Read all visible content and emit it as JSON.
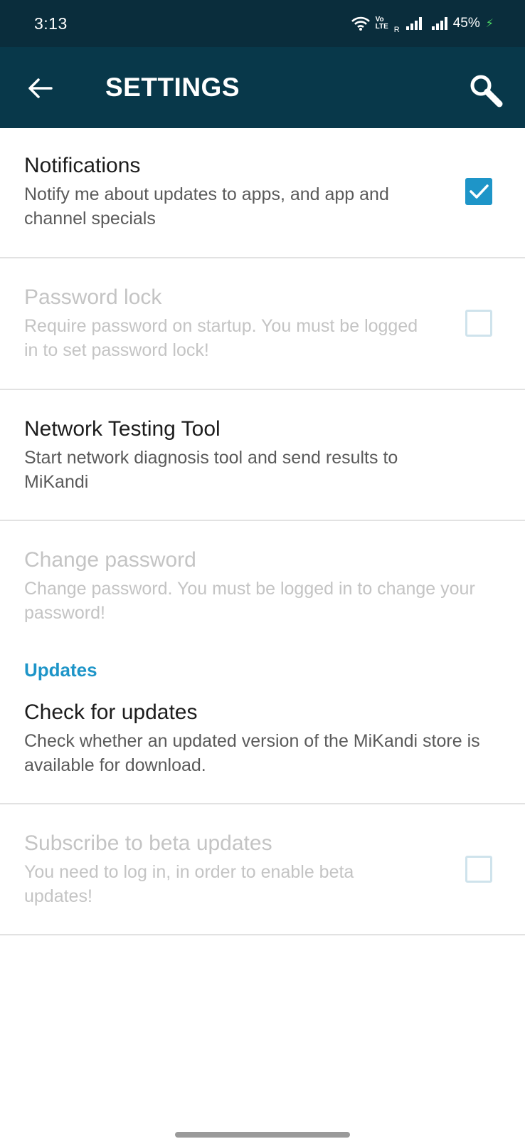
{
  "status_bar": {
    "time": "3:13",
    "volte_top": "Vo",
    "volte_bottom": "LTE",
    "roaming": "R",
    "battery": "45%",
    "icons": [
      "wifi-icon",
      "volte-icon",
      "signal-icon",
      "signal-icon",
      "charging-icon"
    ]
  },
  "app_bar": {
    "title": "SETTINGS",
    "back_icon": "arrow-left-icon",
    "search_icon": "search-icon"
  },
  "settings": [
    {
      "title": "Notifications",
      "desc": "Notify me about updates to apps, and app and channel specials",
      "checkbox": "checked",
      "enabled": true
    },
    {
      "title": "Password lock",
      "desc": "Require password on startup. You must be logged in to set password lock!",
      "checkbox": "unchecked",
      "enabled": false
    },
    {
      "title": "Network Testing Tool",
      "desc": "Start network diagnosis tool and send results to MiKandi",
      "enabled": true
    },
    {
      "title": "Change password",
      "desc": "Change password. You must be logged in to change your password!",
      "enabled": false
    }
  ],
  "updates_section": {
    "header": "Updates",
    "items": [
      {
        "title": "Check for updates",
        "desc": "Check whether an updated version of the MiKandi store is available for download.",
        "enabled": true
      },
      {
        "title": "Subscribe to beta updates",
        "desc": "You need to log in, in order to enable beta updates!",
        "checkbox": "unchecked",
        "enabled": false
      }
    ]
  },
  "colors": {
    "status_bar": "#0a2d3c",
    "app_bar": "#08384a",
    "accent": "#1e95c8",
    "disabled_text": "#c4c4c4"
  }
}
